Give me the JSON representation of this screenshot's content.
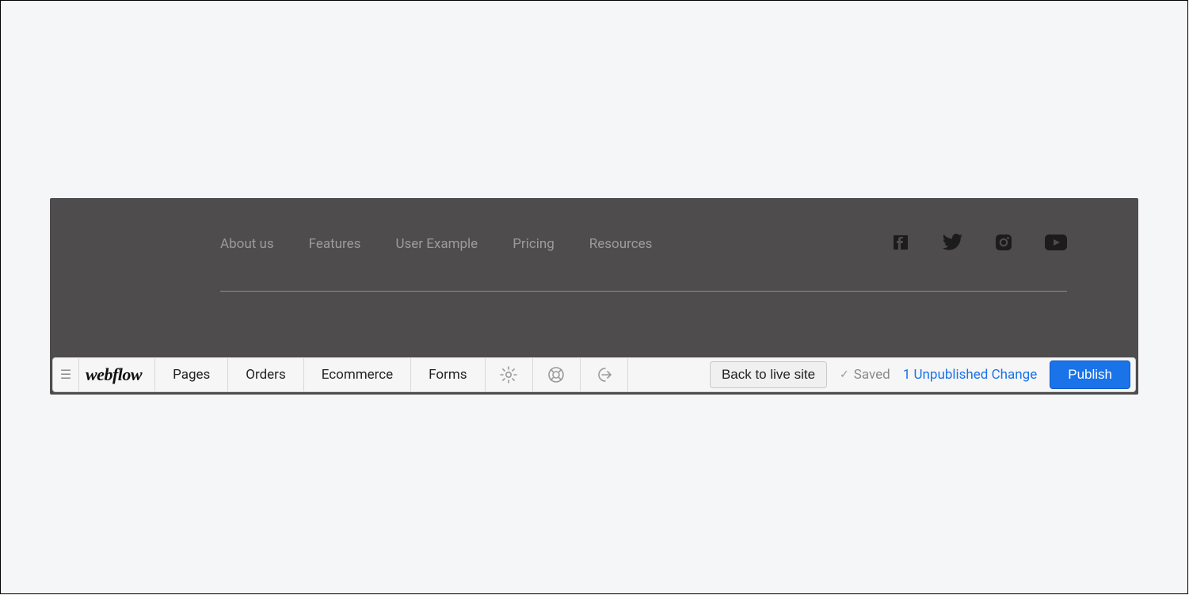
{
  "footer": {
    "nav": [
      {
        "label": "About us"
      },
      {
        "label": "Features"
      },
      {
        "label": "User Example"
      },
      {
        "label": "Pricing"
      },
      {
        "label": "Resources"
      }
    ],
    "social": {
      "facebook": "facebook-icon",
      "twitter": "twitter-icon",
      "instagram": "instagram-icon",
      "youtube": "youtube-icon"
    }
  },
  "editor": {
    "logo": "webflow",
    "tabs": {
      "pages": "Pages",
      "orders": "Orders",
      "ecommerce": "Ecommerce",
      "forms": "Forms"
    },
    "back_to_live": "Back to live site",
    "saved": "Saved",
    "unpublished": "1 Unpublished Change",
    "publish": "Publish"
  }
}
